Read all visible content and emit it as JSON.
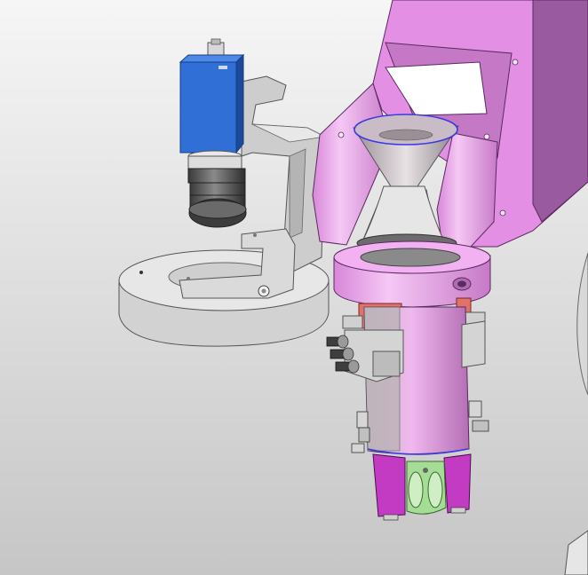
{
  "viewport": {
    "background_top": "#f6f6f6",
    "background_bottom": "#c6c6c6"
  },
  "colors": {
    "arm_magenta": "#e38fe3",
    "arm_magenta_dark": "#9a5aa0",
    "arm_magenta_light": "#f4c4f4",
    "camera_blue": "#2f6fd6",
    "camera_blue_dark": "#1b4a9c",
    "steel_light": "#e4e4e4",
    "steel_mid": "#bdbdbd",
    "steel_dark": "#8c8c8c",
    "lens_dark": "#4a4a4a",
    "clamp_red": "#e0726a",
    "gripper_green": "#a6dd96",
    "edge_blue": "#3a3ae0"
  }
}
